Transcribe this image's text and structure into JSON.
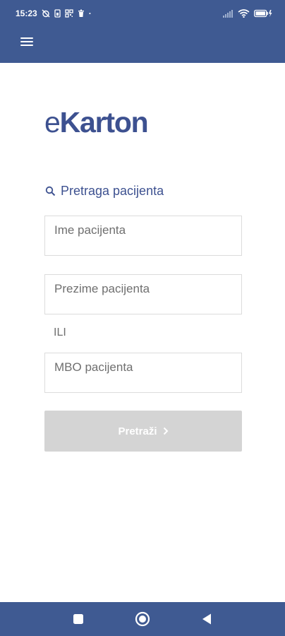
{
  "status_bar": {
    "time": "15:23",
    "dot": "·"
  },
  "app": {
    "logo_prefix": "e",
    "logo_main": "Karton"
  },
  "search": {
    "heading": "Pretraga pacijenta",
    "first_name_placeholder": "Ime pacijenta",
    "last_name_placeholder": "Prezime pacijenta",
    "separator": "ILI",
    "mbo_placeholder": "MBO pacijenta",
    "submit_label": "Pretraži",
    "submit_icon": "chevron-right-icon"
  },
  "colors": {
    "brand": "#3f5a92",
    "logo": "#3d5190",
    "disabled_button": "#d4d4d4"
  }
}
